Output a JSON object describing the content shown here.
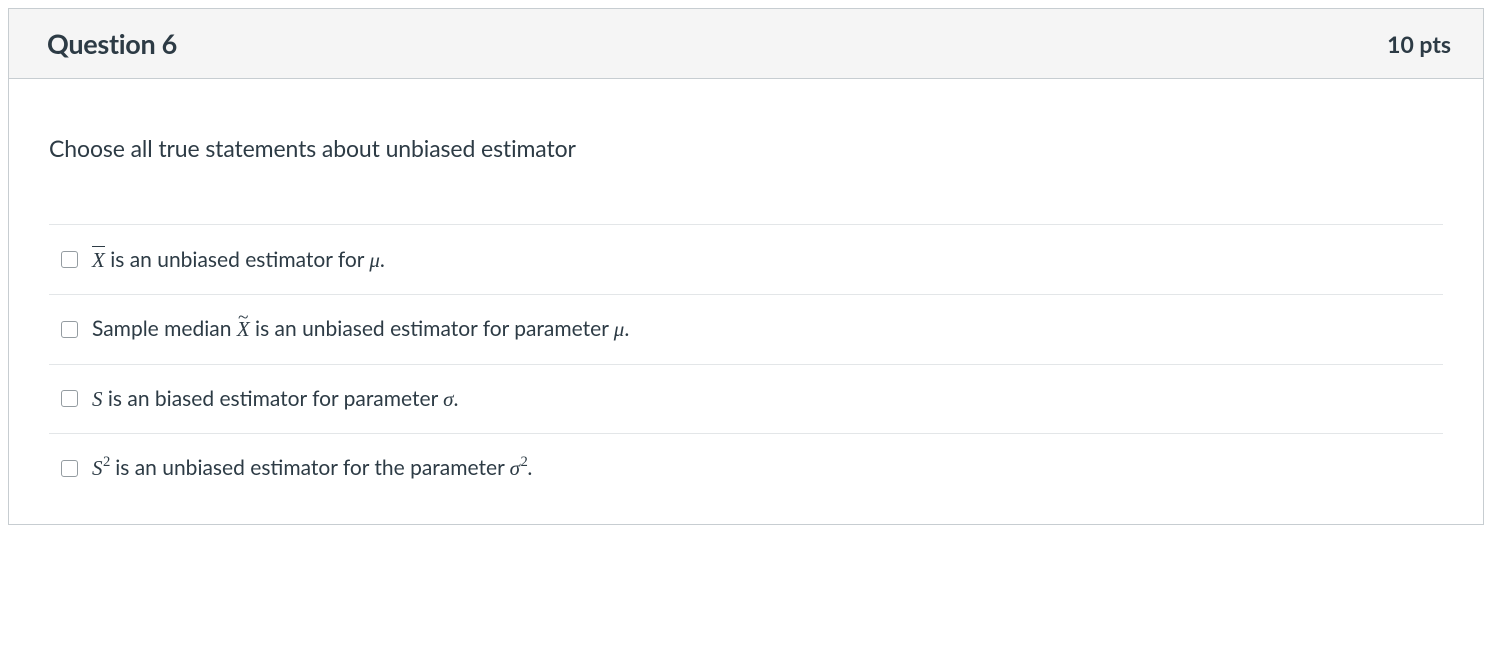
{
  "header": {
    "title": "Question 6",
    "points": "10 pts"
  },
  "prompt": "Choose all true statements about unbiased estimator",
  "answers": [
    {
      "pre": "",
      "math": "<span class=\"overline mi\">X</span>",
      "mid": " is an unbiased estimator for ",
      "math2": "<span class=\"mi\">μ</span>",
      "post": "."
    },
    {
      "pre": "Sample median ",
      "math": "<span class=\"mtilde mi\">X</span>",
      "mid": " is an unbiased estimator for parameter ",
      "math2": "<span class=\"mi\">μ</span>",
      "post": "."
    },
    {
      "pre": "",
      "math": "<span class=\"mi\">S</span>",
      "mid": " is an biased estimator for parameter ",
      "math2": "<span class=\"mi\">σ</span>",
      "post": "."
    },
    {
      "pre": "",
      "math": "<span class=\"mi\">S</span><span class=\"mi msup\">2</span>",
      "mid": " is an unbiased estimator for the parameter ",
      "math2": "<span class=\"mi\">σ</span><span class=\"mi msup\">2</span>",
      "post": "."
    }
  ]
}
